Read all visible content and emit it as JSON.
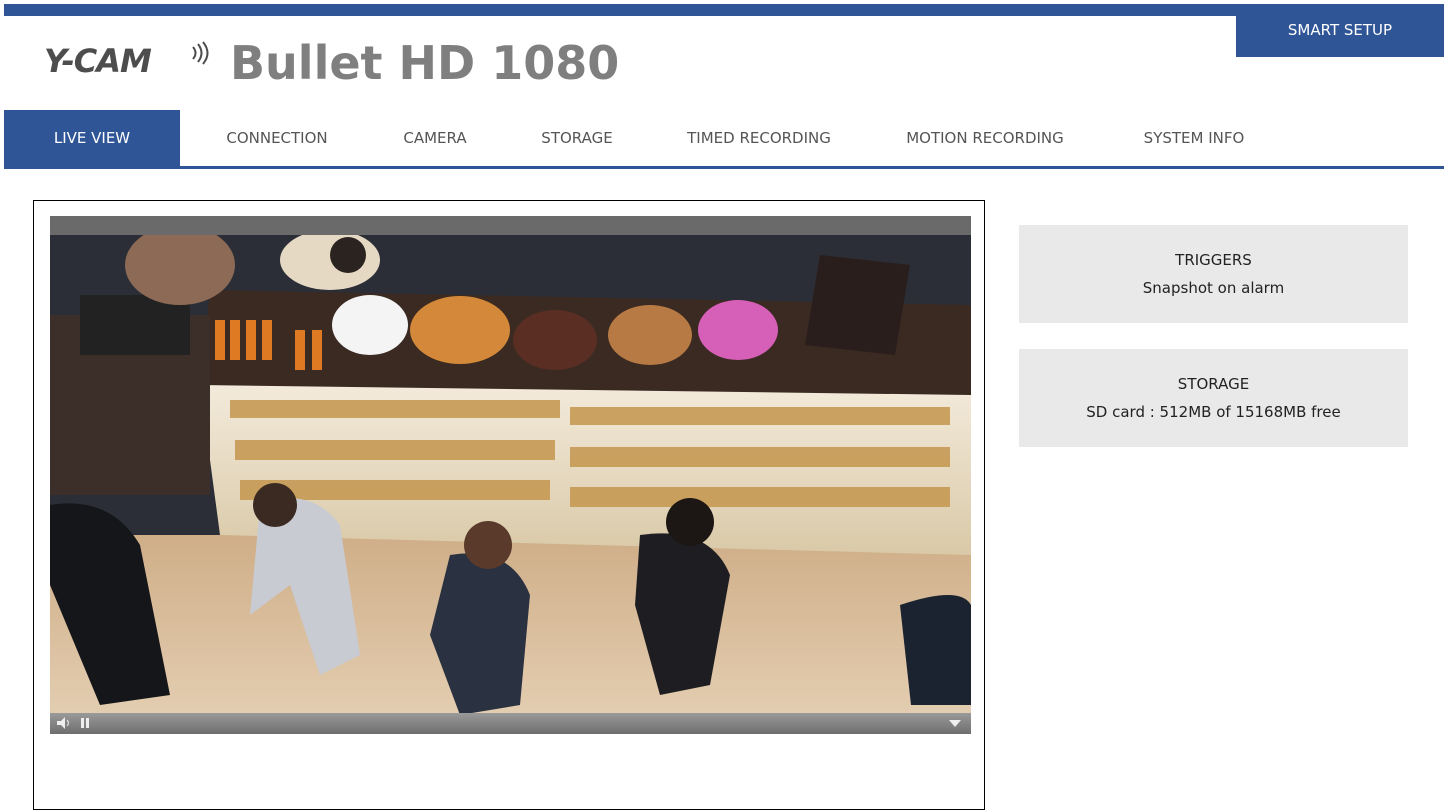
{
  "header": {
    "brand": "Y-CAM",
    "product_title": "Bullet HD 1080",
    "smart_setup_label": "SMART SETUP"
  },
  "nav": {
    "items": [
      {
        "label": "LIVE VIEW",
        "active": true
      },
      {
        "label": "CONNECTION",
        "active": false
      },
      {
        "label": "CAMERA",
        "active": false
      },
      {
        "label": "STORAGE",
        "active": false
      },
      {
        "label": "TIMED RECORDING",
        "active": false
      },
      {
        "label": "MOTION RECORDING",
        "active": false
      },
      {
        "label": "SYSTEM INFO",
        "active": false
      }
    ]
  },
  "panels": {
    "triggers": {
      "title": "TRIGGERS",
      "value": "Snapshot on alarm"
    },
    "storage": {
      "title": "STORAGE",
      "value": "SD card : 512MB of 15168MB free"
    }
  },
  "player": {
    "controls": [
      "volume-icon",
      "pause-icon",
      "menu-arrow-icon"
    ]
  },
  "colors": {
    "accent": "#2f5597",
    "panel_bg": "#e9e9e9"
  }
}
